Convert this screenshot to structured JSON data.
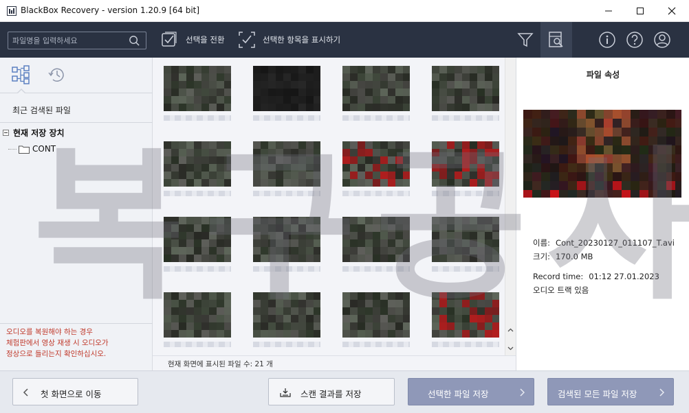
{
  "window": {
    "title": "BlackBox Recovery - version 1.20.9 [64 bit]"
  },
  "toolbar": {
    "search_placeholder": "파일명을 입력하세요",
    "toggle_selection_label": "선택을 전환",
    "show_selected_label": "선택한 항목을 표시하기"
  },
  "left_panel": {
    "recent_files_label": "최근 검색된 파일",
    "tree": {
      "root_label": "현재 저장 장치",
      "children": [
        "CONT"
      ]
    },
    "notice_lines": [
      "오디오를 복원해야 하는 경우",
      "체험판에서 영상 재생 시 오디오가",
      "정상으로 들리는지 확인하십시오."
    ]
  },
  "grid": {
    "status_text": "현재 화면에 표시된 파일 수:  21 개"
  },
  "file_properties": {
    "title": "파일 속성",
    "name_label": "이름:",
    "name_value": "Cont_20230127_011107_T.avi",
    "size_label": "크기:",
    "size_value": "170.0 MB",
    "record_time_label": "Record time:",
    "record_time_value": "01:12 27.01.2023",
    "audio_track": "오디오 트랙 있음"
  },
  "watermark": {
    "text": "복구공사"
  },
  "bottom": {
    "home_button": "첫 화면으로 이동",
    "save_scan_button": "스캔 결과를 저장",
    "save_selected_button": "선택한 파일 저장",
    "save_all_button": "검색된 모든 파일 저장"
  },
  "colors": {
    "toolbar_bg": "#2a3242",
    "primary_button": "#8f98b8",
    "notice_text": "#c0392b"
  }
}
